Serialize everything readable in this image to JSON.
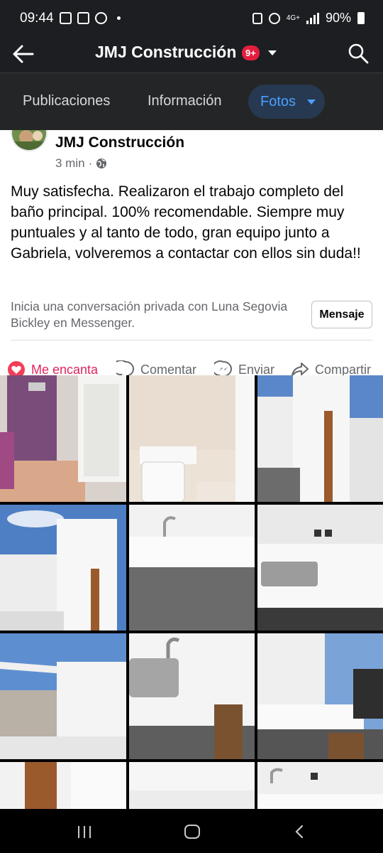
{
  "status_bar": {
    "time": "09:44",
    "network": "4G+",
    "battery": "90%"
  },
  "header": {
    "title": "JMJ Construcción",
    "badge": "9+"
  },
  "tabs": [
    {
      "label": "Publicaciones"
    },
    {
      "label": "Información"
    },
    {
      "label": "Fotos",
      "active": true
    }
  ],
  "post": {
    "author": "JMJ Construcción",
    "time": "3 min",
    "audience_icon": "globe-icon",
    "text": "Muy satisfecha. Realizaron el trabajo completo del baño principal. 100% recomendable. Siempre muy puntuales y al tanto de todo, gran equipo junto a Gabriela, volveremos a contactar con ellos sin duda!!",
    "messenger_prompt": "Inicia una conversación privada con Luna Segovia Bickley en Messenger.",
    "message_button": "Mensaje",
    "actions": {
      "like": "Me encanta",
      "comment": "Comentar",
      "send": "Enviar",
      "share": "Compartir"
    }
  },
  "photos": [
    {
      "subject": "bathroom-door"
    },
    {
      "subject": "toilet-sink"
    },
    {
      "subject": "outdoor-shower"
    },
    {
      "subject": "terrace-shower"
    },
    {
      "subject": "faucet-counter"
    },
    {
      "subject": "outdoor-sink"
    },
    {
      "subject": "terrace-shade"
    },
    {
      "subject": "sink-closeup"
    },
    {
      "subject": "outdoor-counter-chair"
    },
    {
      "subject": "wooden-shower"
    },
    {
      "subject": "white-counter"
    },
    {
      "subject": "counter-faucet"
    }
  ],
  "colors": {
    "header_bg": "#1c1e21",
    "tab_active": "#4c9eff",
    "badge": "#e41e3f",
    "like": "#e0245e"
  }
}
